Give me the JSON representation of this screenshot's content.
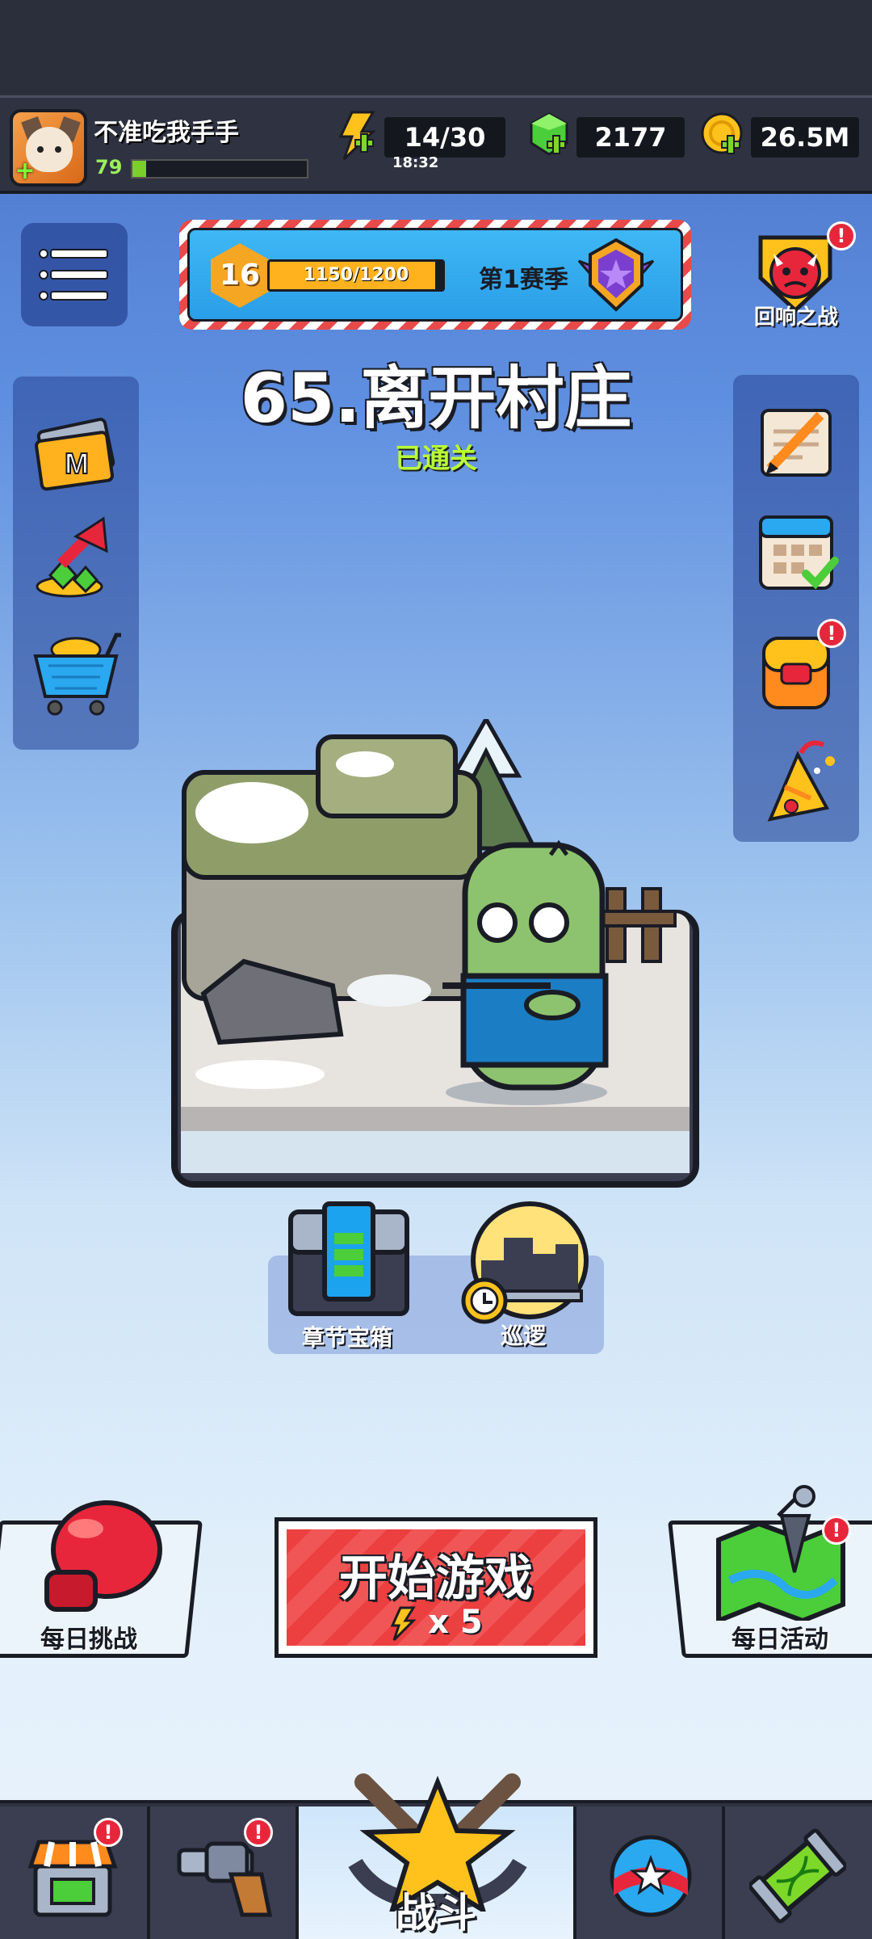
{
  "player": {
    "name": "不准吃我手手",
    "level": "79",
    "xp_progress": 0.08
  },
  "resources": {
    "energy": "14/30",
    "energy_timer": "18:32",
    "gems": "2177",
    "coins": "26.5M"
  },
  "season": {
    "level": "16",
    "progress_text": "1150/1200",
    "progress": 0.958,
    "label": "第1赛季"
  },
  "echo_battle": {
    "label": "回响之战",
    "alert": "!"
  },
  "stage": {
    "title": "65.离开村庄",
    "status": "已通关"
  },
  "stage_actions": {
    "chest_label": "章节宝箱",
    "patrol_label": "巡逻"
  },
  "start_game": {
    "label": "开始游戏",
    "cost": "x 5"
  },
  "daily_challenge": {
    "label": "每日挑战"
  },
  "daily_activity": {
    "label": "每日活动",
    "alert": "!"
  },
  "left_icons": [
    "coupon-icon",
    "growth-fund-icon",
    "shop-cart-icon"
  ],
  "right_icons": [
    "quest-scroll-icon",
    "calendar-checkin-icon",
    "backpack-icon",
    "party-popper-icon"
  ],
  "alerts": {
    "backpack": "!",
    "shop_tab": "!",
    "weapon_tab": "!"
  },
  "nav": {
    "battle_label": "战斗"
  }
}
